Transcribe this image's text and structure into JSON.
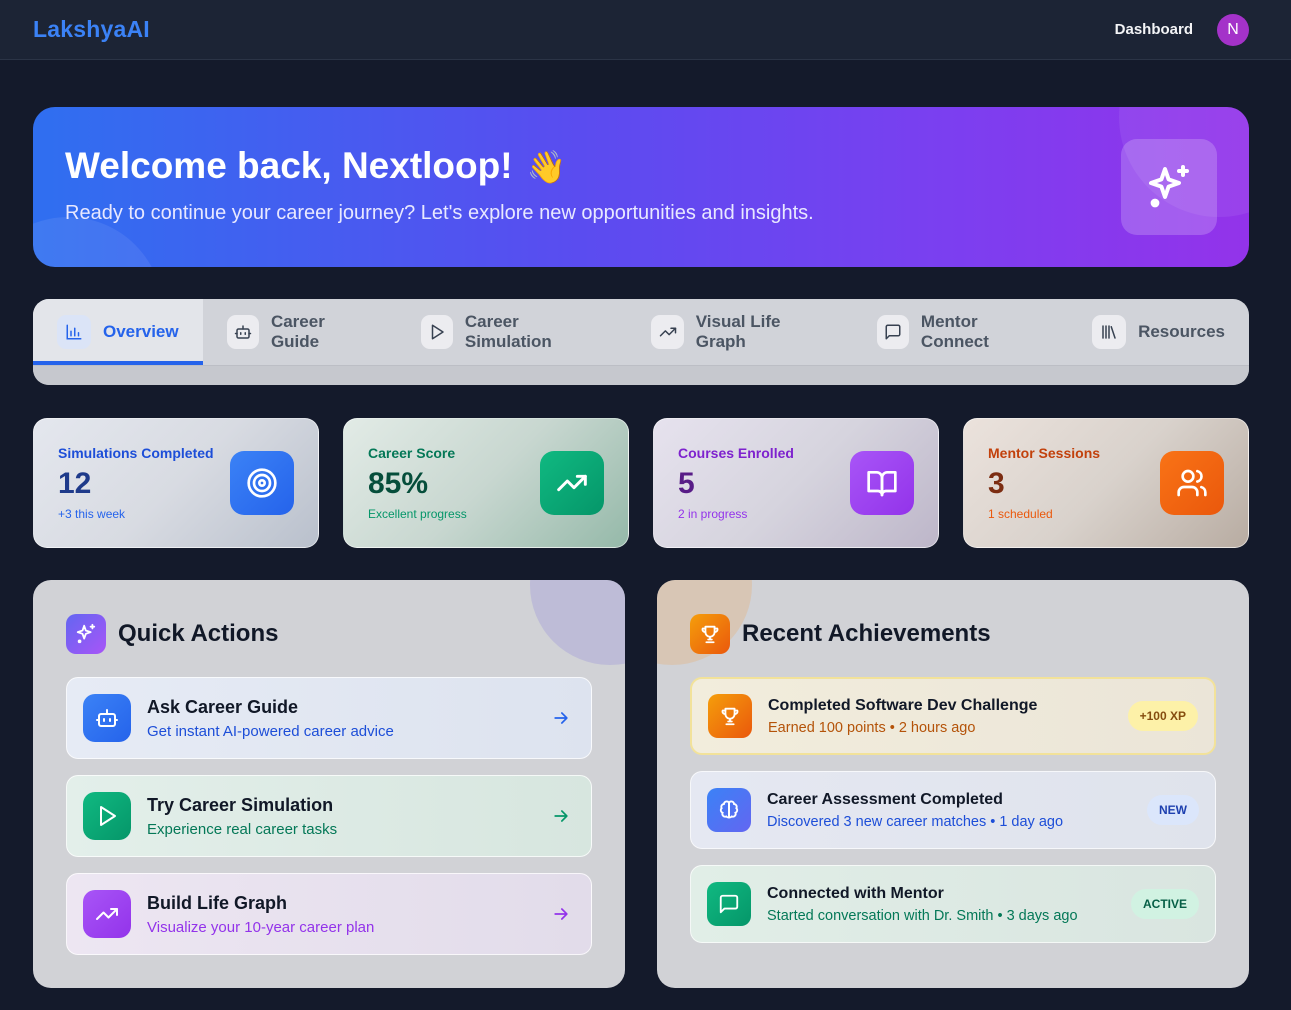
{
  "app": {
    "logo": "LakshyaAI",
    "nav_dashboard": "Dashboard",
    "avatar_initial": "N"
  },
  "hero": {
    "title": "Welcome back, Nextloop!",
    "wave": "👋",
    "subtitle": "Ready to continue your career journey? Let's explore new opportunities and insights.",
    "badge_icon": "sparkles-icon"
  },
  "tabs": [
    {
      "label": "Overview",
      "icon": "bar-chart-icon",
      "active": true
    },
    {
      "label": "Career Guide",
      "icon": "bot-icon",
      "active": false
    },
    {
      "label": "Career Simulation",
      "icon": "play-icon",
      "active": false
    },
    {
      "label": "Visual Life Graph",
      "icon": "trending-up-icon",
      "active": false
    },
    {
      "label": "Mentor Connect",
      "icon": "message-square-icon",
      "active": false
    },
    {
      "label": "Resources",
      "icon": "library-icon",
      "active": false
    }
  ],
  "stats": [
    {
      "label": "Simulations Completed",
      "value": "12",
      "note": "+3 this week",
      "icon": "target-icon",
      "color": "#3b82f6"
    },
    {
      "label": "Career Score",
      "value": "85%",
      "note": "Excellent progress",
      "icon": "trending-up-icon",
      "color": "#10b981"
    },
    {
      "label": "Courses Enrolled",
      "value": "5",
      "note": "2 in progress",
      "icon": "book-open-icon",
      "color": "#a855f7"
    },
    {
      "label": "Mentor Sessions",
      "value": "3",
      "note": "1 scheduled",
      "icon": "users-icon",
      "color": "#f97316"
    }
  ],
  "quick_actions": {
    "title": "Quick Actions",
    "items": [
      {
        "title": "Ask Career Guide",
        "subtitle": "Get instant AI-powered career advice",
        "icon": "bot-icon"
      },
      {
        "title": "Try Career Simulation",
        "subtitle": "Experience real career tasks",
        "icon": "play-icon"
      },
      {
        "title": "Build Life Graph",
        "subtitle": "Visualize your 10-year career plan",
        "icon": "trending-up-icon"
      }
    ]
  },
  "achievements": {
    "title": "Recent Achievements",
    "items": [
      {
        "title": "Completed Software Dev Challenge",
        "subtitle": "Earned 100 points • 2 hours ago",
        "badge": "+100 XP",
        "icon": "trophy-icon"
      },
      {
        "title": "Career Assessment Completed",
        "subtitle": "Discovered 3 new career matches • 1 day ago",
        "badge": "NEW",
        "icon": "brain-icon"
      },
      {
        "title": "Connected with Mentor",
        "subtitle": "Started conversation with Dr. Smith • 3 days ago",
        "badge": "ACTIVE",
        "icon": "message-square-icon"
      }
    ]
  }
}
